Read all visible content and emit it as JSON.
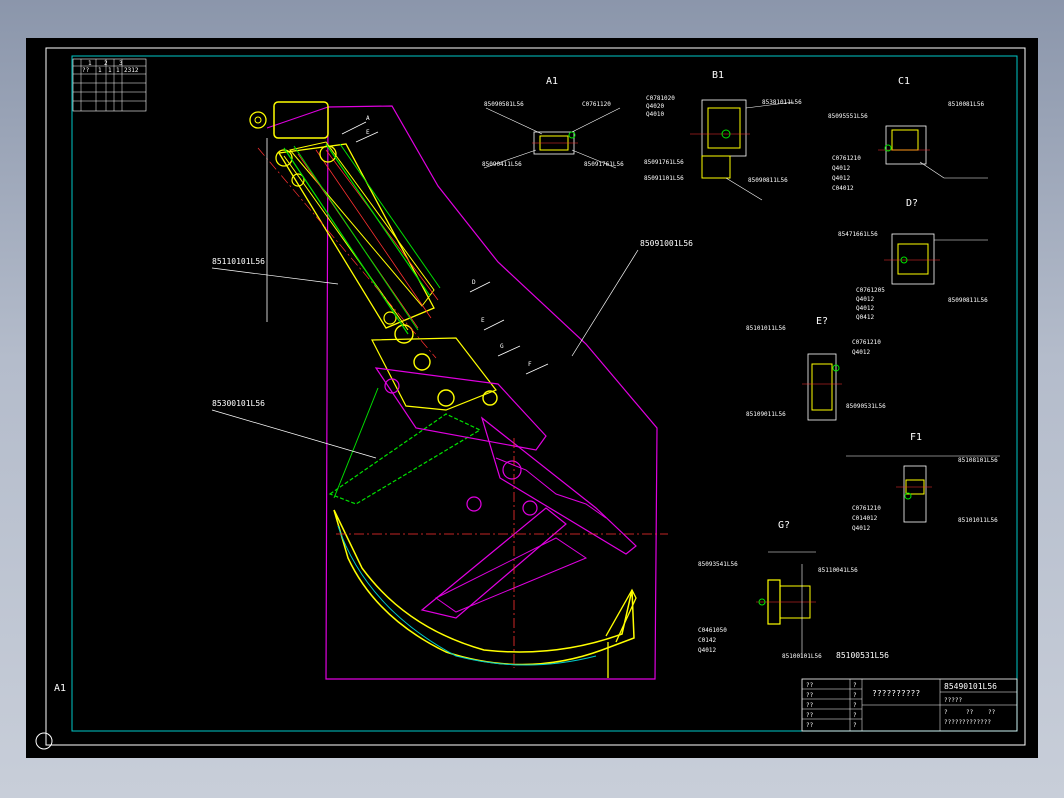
{
  "sheet": {
    "size_label": "A1",
    "border_color": "#ffffff",
    "frame_color": "#00c8c8"
  },
  "revision_table": {
    "header": [
      "1",
      "2",
      "3"
    ],
    "row": [
      "??",
      "1",
      "1",
      "1",
      "2312"
    ]
  },
  "views": {
    "a": "A1",
    "b": "B1",
    "c": "C1",
    "d": "D?",
    "e": "E?",
    "f": "F1",
    "g": "G?"
  },
  "main_callouts": {
    "upper_arm": "85110101L56",
    "bucket": "85300101L56",
    "cover": "85091001L56"
  },
  "main_arrows": [
    "A",
    "E",
    "D",
    "E",
    "G",
    "F"
  ],
  "detail_a": {
    "labels": [
      "85090581L56",
      "C0761120",
      "85090411L56",
      "85091761L56"
    ]
  },
  "detail_b": {
    "stack": [
      "C0781020",
      "Q4020",
      "Q4010"
    ],
    "labels": [
      "85381011L56",
      "85091761L56",
      "85091101L56",
      "85090811L56"
    ]
  },
  "detail_c": {
    "labels": [
      "85095551L56",
      "8510081L56"
    ],
    "stack": [
      "C0761210",
      "Q4012",
      "Q4012",
      "C04012"
    ]
  },
  "detail_d": {
    "labels": [
      "85471661L56",
      "85090811L56"
    ],
    "stack": [
      "C0761205",
      "Q4012",
      "Q4012",
      "Q0412"
    ]
  },
  "detail_e": {
    "labels": [
      "85101011L56",
      "85109011L56",
      "85090531L56"
    ],
    "stack": [
      "C0761210",
      "Q4012"
    ]
  },
  "detail_f": {
    "labels": [
      "85108101L56",
      "85101011L56"
    ],
    "stack": [
      "C0761210",
      "C014012",
      "Q4012"
    ]
  },
  "detail_g": {
    "labels": [
      "85093541L56",
      "85110041L56",
      "85100531L56",
      "85100101L56"
    ],
    "stack": [
      "C0461050",
      "C0142",
      "Q4012"
    ]
  },
  "title_block": {
    "drawing_no": "85490101L56",
    "name": "??????????",
    "sub_name": "?????",
    "company": "?????????????",
    "roles": [
      "??",
      "??",
      "??",
      "??",
      "??"
    ],
    "role_marks": [
      "?",
      "?",
      "?",
      "?",
      "?"
    ],
    "scale_cells": [
      "?",
      "??",
      "??"
    ]
  }
}
